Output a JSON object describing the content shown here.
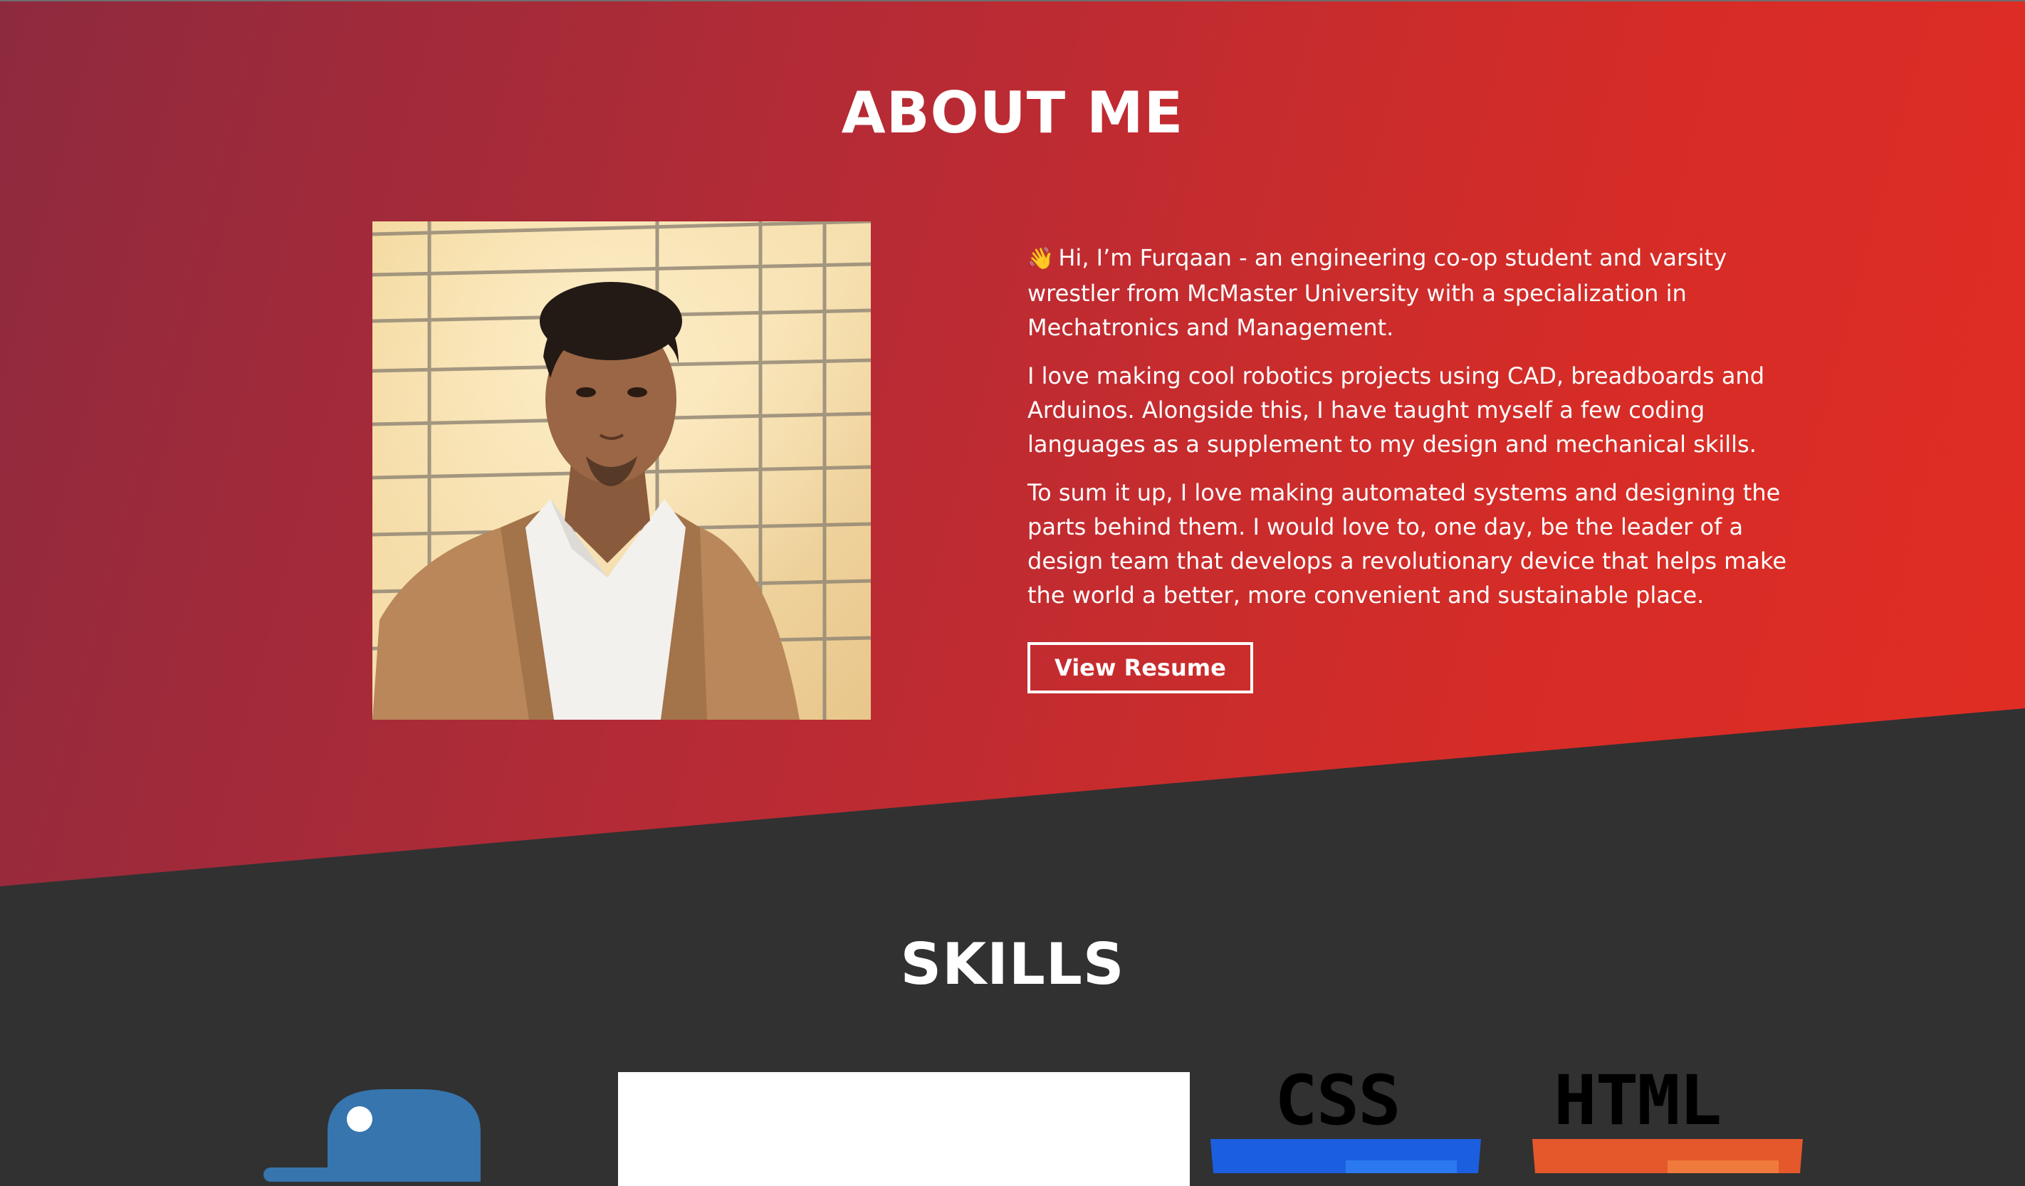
{
  "about": {
    "title": "ABOUT ME",
    "wave_icon": "waving-hand-icon",
    "paragraphs": [
      "Hi, I’m Furqaan - an engineering co-op student and varsity wrestler from McMaster University with a specialization in Mechatronics and Management.",
      "I love making cool robotics projects using CAD, breadboards and Arduinos. Alongside this, I have taught myself a few coding languages as a supplement to my design and mechanical skills.",
      "To sum it up, I love making automated systems and designing the parts behind them. I would love to, one day, be the leader of a design team that develops a revolutionary device that helps make the world a better, more convenient and sustainable place."
    ],
    "resume_button": "View Resume"
  },
  "skills": {
    "title": "SKILLS",
    "logos": [
      {
        "name": "python-logo",
        "text": ""
      },
      {
        "name": "white-card",
        "text": ""
      },
      {
        "name": "css-logo",
        "text": "CSS"
      },
      {
        "name": "html-logo",
        "text": "HTML"
      }
    ]
  },
  "colors": {
    "gradient_start": "#8e2a3e",
    "gradient_end": "#e12d24",
    "dark_bg": "#313131",
    "css_blue": "#1b5fe0",
    "html_orange": "#e4582b",
    "python_blue": "#3675ad"
  }
}
